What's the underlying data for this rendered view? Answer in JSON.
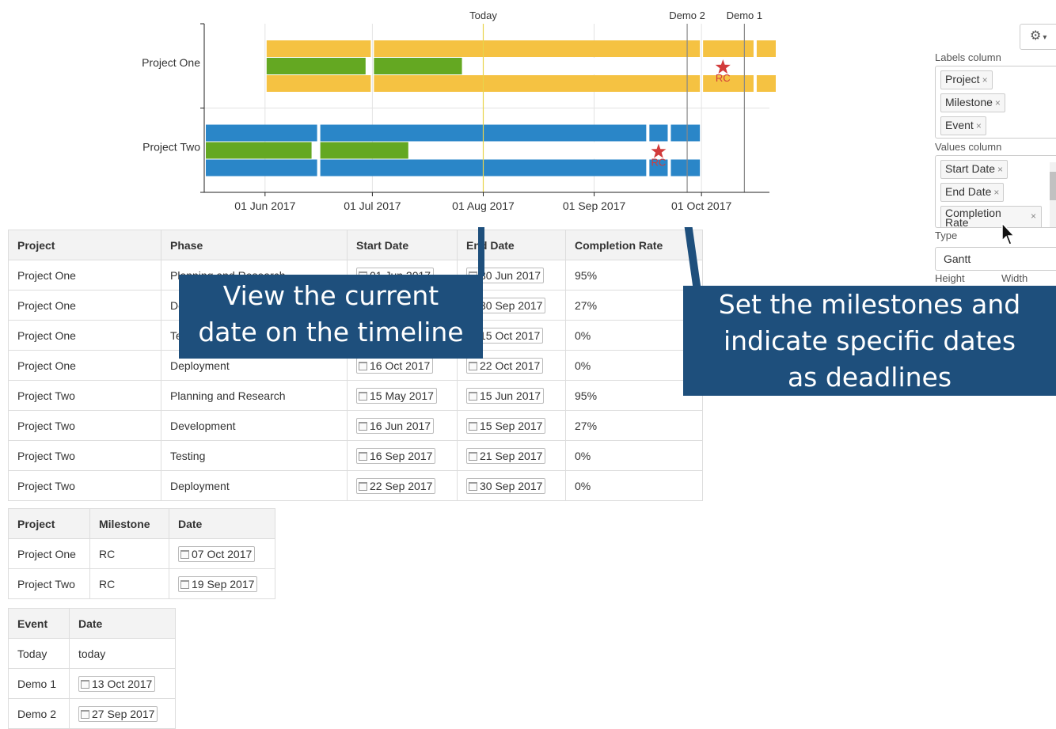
{
  "chart_data": {
    "type": "gantt",
    "x_ticks": [
      "01 Jun 2017",
      "01 Jul 2017",
      "01 Aug 2017",
      "01 Sep 2017",
      "01 Oct 2017"
    ],
    "x_range": [
      "2017-05-15",
      "2017-10-20"
    ],
    "categories": [
      "Project One",
      "Project Two"
    ],
    "colors": {
      "project_one": "#f5c242",
      "project_two": "#2a86c8",
      "completion": "#64a822",
      "today_line": "#e8d44d",
      "demo_line": "#888888",
      "milestone": "#d23b3b"
    },
    "tasks": [
      {
        "project": "Project One",
        "start": "2017-06-01",
        "end": "2017-06-30",
        "completion": 95
      },
      {
        "project": "Project One",
        "start": "2017-07-01",
        "end": "2017-09-30",
        "completion": 27
      },
      {
        "project": "Project One",
        "start": "2017-10-01",
        "end": "2017-10-15",
        "completion": 0
      },
      {
        "project": "Project One",
        "start": "2017-10-16",
        "end": "2017-10-22",
        "completion": 0
      },
      {
        "project": "Project Two",
        "start": "2017-05-15",
        "end": "2017-06-15",
        "completion": 95
      },
      {
        "project": "Project Two",
        "start": "2017-06-16",
        "end": "2017-09-15",
        "completion": 27
      },
      {
        "project": "Project Two",
        "start": "2017-09-16",
        "end": "2017-09-21",
        "completion": 0
      },
      {
        "project": "Project Two",
        "start": "2017-09-22",
        "end": "2017-09-30",
        "completion": 0
      }
    ],
    "milestones": [
      {
        "project": "Project One",
        "label": "RC",
        "date": "2017-10-07"
      },
      {
        "project": "Project Two",
        "label": "RC",
        "date": "2017-09-19"
      }
    ],
    "events": [
      {
        "label": "Today",
        "date": "2017-08-01"
      },
      {
        "label": "Demo 2",
        "date": "2017-09-27"
      },
      {
        "label": "Demo 1",
        "date": "2017-10-13"
      }
    ]
  },
  "phases_table": {
    "headers": [
      "Project",
      "Phase",
      "Start Date",
      "End Date",
      "Completion Rate"
    ],
    "rows": [
      [
        "Project One",
        "Planning and Research",
        "01 Jun 2017",
        "30 Jun 2017",
        "95%"
      ],
      [
        "Project One",
        "Development",
        "01 Jul 2017",
        "30 Sep 2017",
        "27%"
      ],
      [
        "Project One",
        "Testing",
        "01 Oct 2017",
        "15 Oct 2017",
        "0%"
      ],
      [
        "Project One",
        "Deployment",
        "16 Oct 2017",
        "22 Oct 2017",
        "0%"
      ],
      [
        "Project Two",
        "Planning and Research",
        "15 May 2017",
        "15 Jun 2017",
        "95%"
      ],
      [
        "Project Two",
        "Development",
        "16 Jun 2017",
        "15 Sep 2017",
        "27%"
      ],
      [
        "Project Two",
        "Testing",
        "16 Sep 2017",
        "21 Sep 2017",
        "0%"
      ],
      [
        "Project Two",
        "Deployment",
        "22 Sep 2017",
        "30 Sep 2017",
        "0%"
      ]
    ]
  },
  "milestones_table": {
    "headers": [
      "Project",
      "Milestone",
      "Date"
    ],
    "rows": [
      [
        "Project One",
        "RC",
        "07 Oct 2017"
      ],
      [
        "Project Two",
        "RC",
        "19 Sep 2017"
      ]
    ]
  },
  "events_table": {
    "headers": [
      "Event",
      "Date"
    ],
    "rows": [
      [
        "Today",
        "today",
        false
      ],
      [
        "Demo 1",
        "13 Oct 2017",
        true
      ],
      [
        "Demo 2",
        "27 Sep 2017",
        true
      ]
    ]
  },
  "callouts": {
    "today": [
      "View the current",
      "date on the timeline"
    ],
    "milestones": [
      "Set the milestones and",
      "indicate specific dates",
      "as deadlines"
    ]
  },
  "panel": {
    "labels_column_title": "Labels column",
    "labels_tags": [
      "Project",
      "Milestone",
      "Event"
    ],
    "values_column_title": "Values column",
    "values_tags": [
      "Start Date",
      "End Date",
      "Completion Rate"
    ],
    "type_title": "Type",
    "type_value": "Gantt",
    "height_label": "Height",
    "width_label": "Width",
    "remove_glyph": "×"
  }
}
